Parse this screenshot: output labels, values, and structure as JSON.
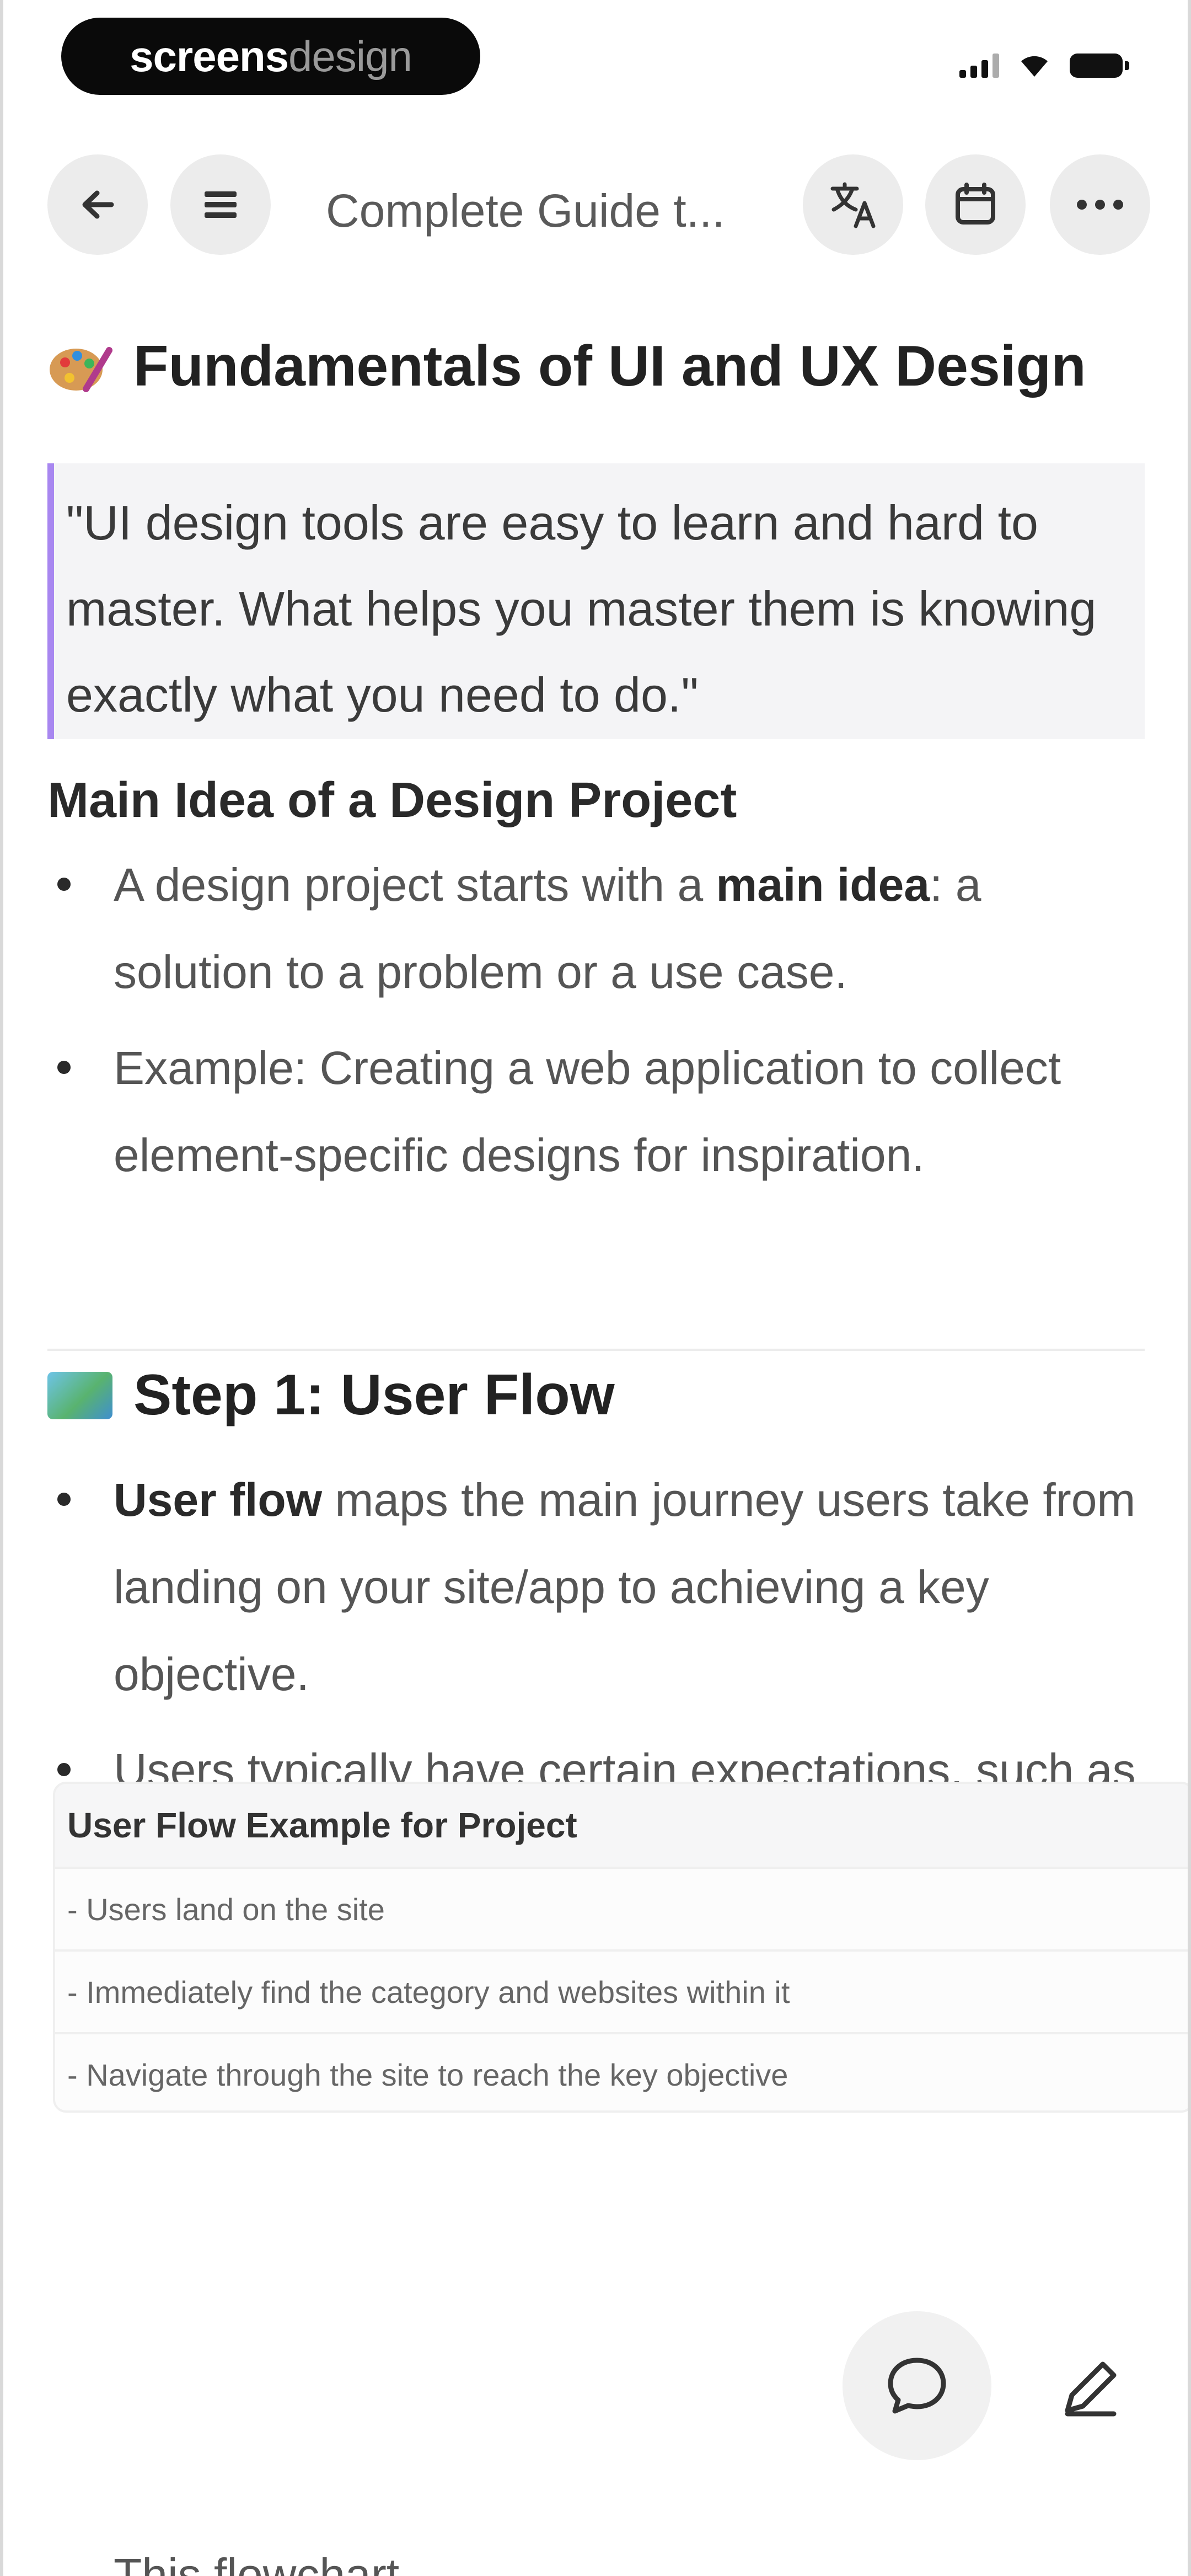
{
  "status_bar": {
    "brand_part1": "screens",
    "brand_part2": "design"
  },
  "toolbar": {
    "title": "Complete Guide t..."
  },
  "article": {
    "heading": "Fundamentals of UI and UX Design",
    "quote": "\"UI design tools are easy to learn and hard to master. What helps you master them is knowing exactly what you need to do.\"",
    "section1": {
      "title": "Main Idea of a Design Project",
      "bullets": [
        {
          "before": "A design project starts with a ",
          "bold": "main idea",
          "after": ": a solution to a problem or a use case."
        },
        {
          "before": "Example: Creating a web application to collect element-specific designs for inspiration.",
          "bold": "",
          "after": ""
        }
      ]
    },
    "section2": {
      "title": "Step 1: User Flow",
      "bullets": [
        {
          "before": "",
          "bold": "User flow",
          "after": " maps the main journey users take from landing on your site/app to achieving a key objective."
        },
        {
          "before": "Users typically have certain expectations, such as finding information, buying something, or using a service.",
          "bold": "",
          "after": ""
        }
      ]
    },
    "table": {
      "header": "User Flow Example for Project",
      "rows": [
        "- Users land on the site",
        "- Immediately find the category and websites within it",
        "- Navigate through the site to reach the key objective"
      ]
    },
    "cutoff_text": "This flowchart…"
  },
  "colors": {
    "accent_quote_bar": "#a887f0",
    "button_bg": "#ececec",
    "text_primary": "#222222",
    "text_secondary": "#555555"
  },
  "icons": {
    "back": "arrow-left-icon",
    "outline": "list-icon",
    "translate": "translate-icon",
    "calendar": "calendar-icon",
    "more": "more-dots-icon",
    "comment": "comment-bubble-icon",
    "edit": "pencil-icon",
    "heading_emoji_1": "palette-emoji-icon",
    "heading_emoji_2": "map-emoji-icon"
  }
}
